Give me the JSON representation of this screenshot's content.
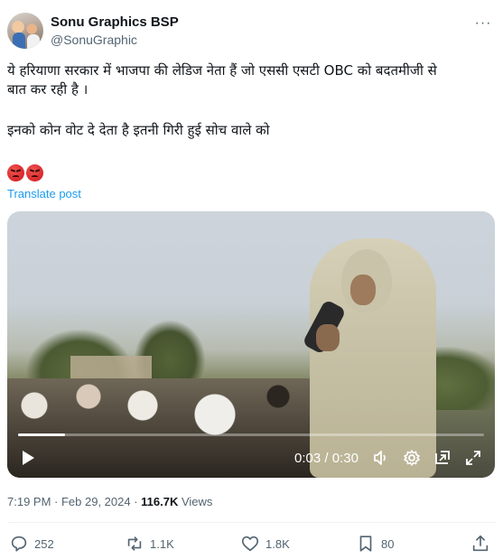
{
  "author": {
    "name": "Sonu Graphics BSP",
    "handle": "@SonuGraphic"
  },
  "tweet": {
    "line1": "ये हरियाणा सरकार में भाजपा की लेडिज नेता हैं जो एससी एसटी OBC को बदतमीजी से",
    "line2": "बात कर रही है ।",
    "line3": "इनको कोन वोट दे देता है इतनी गिरी हुई सोच वाले को",
    "emojis": [
      "angry-face-emoji",
      "angry-face-emoji"
    ],
    "translate_label": "Translate post"
  },
  "video": {
    "current_time": "0:03",
    "separator": " / ",
    "duration": "0:30",
    "progress": 0.1
  },
  "meta": {
    "time": "7:19 PM",
    "sep": " · ",
    "date": "Feb 29, 2024",
    "views_count": "116.7K",
    "views_label": " Views"
  },
  "actions": {
    "replies": "252",
    "reposts": "1.1K",
    "likes": "1.8K",
    "bookmarks": "80"
  },
  "colors": {
    "text": "#0f1419",
    "secondary": "#536471",
    "link": "#1d9bf0",
    "divider": "#eff3f4"
  }
}
